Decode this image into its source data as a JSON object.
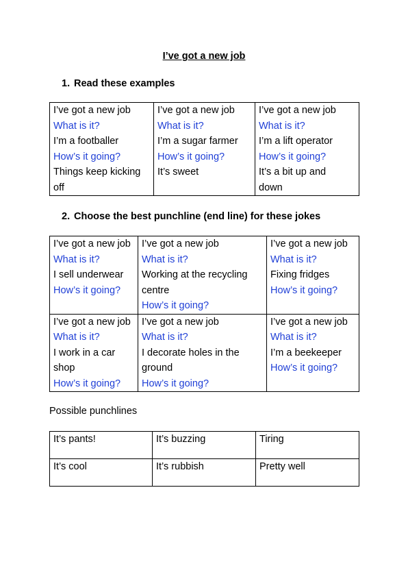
{
  "title": "I’ve got a new job",
  "section1": {
    "number": "1.",
    "heading": "Read these examples",
    "cells": [
      [
        "I’ve got a new job",
        "What is it?",
        "I’m a footballer",
        "How’s it going?",
        "Things keep kicking",
        "off"
      ],
      [
        "I’ve got a new job",
        "What is it?",
        "I’m a sugar farmer",
        "How’s it going?",
        "It’s sweet"
      ],
      [
        "I’ve got a new job",
        "What is it?",
        "I’m a lift operator",
        "How’s it going?",
        "It’s a bit up and",
        "down"
      ]
    ]
  },
  "section2": {
    "number": "2.",
    "heading": "Choose the best punchline (end line) for these jokes",
    "rows": [
      [
        [
          "I’ve got a new job",
          "What is it?",
          "I sell underwear",
          "How’s it going?"
        ],
        [
          "I’ve got a new job",
          "What is it?",
          "Working at the recycling",
          "centre",
          "How’s it going?"
        ],
        [
          "I’ve got a new job",
          "What is it?",
          "Fixing fridges",
          "How’s it going?"
        ]
      ],
      [
        [
          "I’ve got a new job",
          "What is it?",
          "I work in a car",
          "shop",
          "How’s it going?"
        ],
        [
          "I’ve got a new job",
          "What is it?",
          "I decorate holes in the",
          "ground",
          "How’s it going?"
        ],
        [
          "I’ve got a new job",
          "What is it?",
          "I’m a beekeeper",
          "How’s it going?"
        ]
      ]
    ]
  },
  "punchlines": {
    "label": "Possible punchlines",
    "rows": [
      [
        "It’s pants!",
        "It’s buzzing",
        "Tiring"
      ],
      [
        "It’s cool",
        "It’s rubbish",
        "Pretty well"
      ]
    ]
  },
  "colors": {
    "question": "#1f3fd6",
    "text": "#000000"
  }
}
